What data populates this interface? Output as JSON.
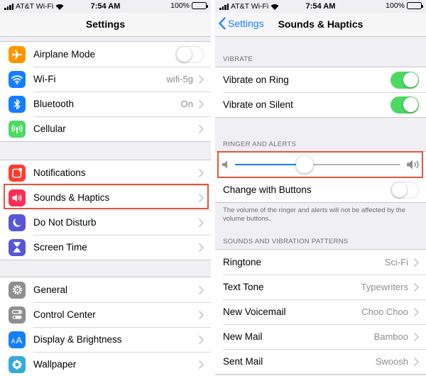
{
  "status_bar": {
    "carrier": "AT&T Wi-Fi",
    "time": "7:54 AM",
    "battery": "100%"
  },
  "colors": {
    "accent": "#157efb",
    "toggle_on": "#4cd964",
    "highlight": "#e8533f"
  },
  "left": {
    "title": "Settings",
    "groups": [
      [
        {
          "label": "Airplane Mode",
          "icon": "airplane-icon",
          "color": "#ff9500",
          "control": "toggle",
          "on": false
        },
        {
          "label": "Wi-Fi",
          "icon": "wifi-icon",
          "color": "#157efb",
          "value": "wifi-5g"
        },
        {
          "label": "Bluetooth",
          "icon": "bluetooth-icon",
          "color": "#157efb",
          "value": "On"
        },
        {
          "label": "Cellular",
          "icon": "cellular-icon",
          "color": "#4cd964",
          "value": ""
        }
      ],
      [
        {
          "label": "Notifications",
          "icon": "notifications-icon",
          "color": "#ff3b30",
          "value": ""
        },
        {
          "label": "Sounds & Haptics",
          "icon": "speaker-icon",
          "color": "#ff2d55",
          "value": "",
          "highlighted": true
        },
        {
          "label": "Do Not Disturb",
          "icon": "moon-icon",
          "color": "#5856d6",
          "value": ""
        },
        {
          "label": "Screen Time",
          "icon": "hourglass-icon",
          "color": "#5856d6",
          "value": ""
        }
      ],
      [
        {
          "label": "General",
          "icon": "gear-icon",
          "color": "#8e8e93",
          "value": ""
        },
        {
          "label": "Control Center",
          "icon": "control-center-icon",
          "color": "#8e8e93",
          "value": ""
        },
        {
          "label": "Display & Brightness",
          "icon": "display-icon",
          "color": "#157efb",
          "value": ""
        },
        {
          "label": "Wallpaper",
          "icon": "wallpaper-icon",
          "color": "#34aadc",
          "value": ""
        }
      ]
    ]
  },
  "right": {
    "title": "Sounds & Haptics",
    "back_label": "Settings",
    "vibrate": {
      "header": "VIBRATE",
      "items": [
        {
          "label": "Vibrate on Ring",
          "on": true
        },
        {
          "label": "Vibrate on Silent",
          "on": true
        }
      ]
    },
    "ringer": {
      "header": "RINGER AND ALERTS",
      "volume": 0.42,
      "change_with_buttons": {
        "label": "Change with Buttons",
        "on": false
      },
      "note": "The volume of the ringer and alerts will not be affected by the volume buttons."
    },
    "patterns": {
      "header": "SOUNDS AND VIBRATION PATTERNS",
      "items": [
        {
          "label": "Ringtone",
          "value": "Sci-Fi"
        },
        {
          "label": "Text Tone",
          "value": "Typewriters"
        },
        {
          "label": "New Voicemail",
          "value": "Choo Choo"
        },
        {
          "label": "New Mail",
          "value": "Bamboo"
        },
        {
          "label": "Sent Mail",
          "value": "Swoosh"
        }
      ]
    }
  }
}
